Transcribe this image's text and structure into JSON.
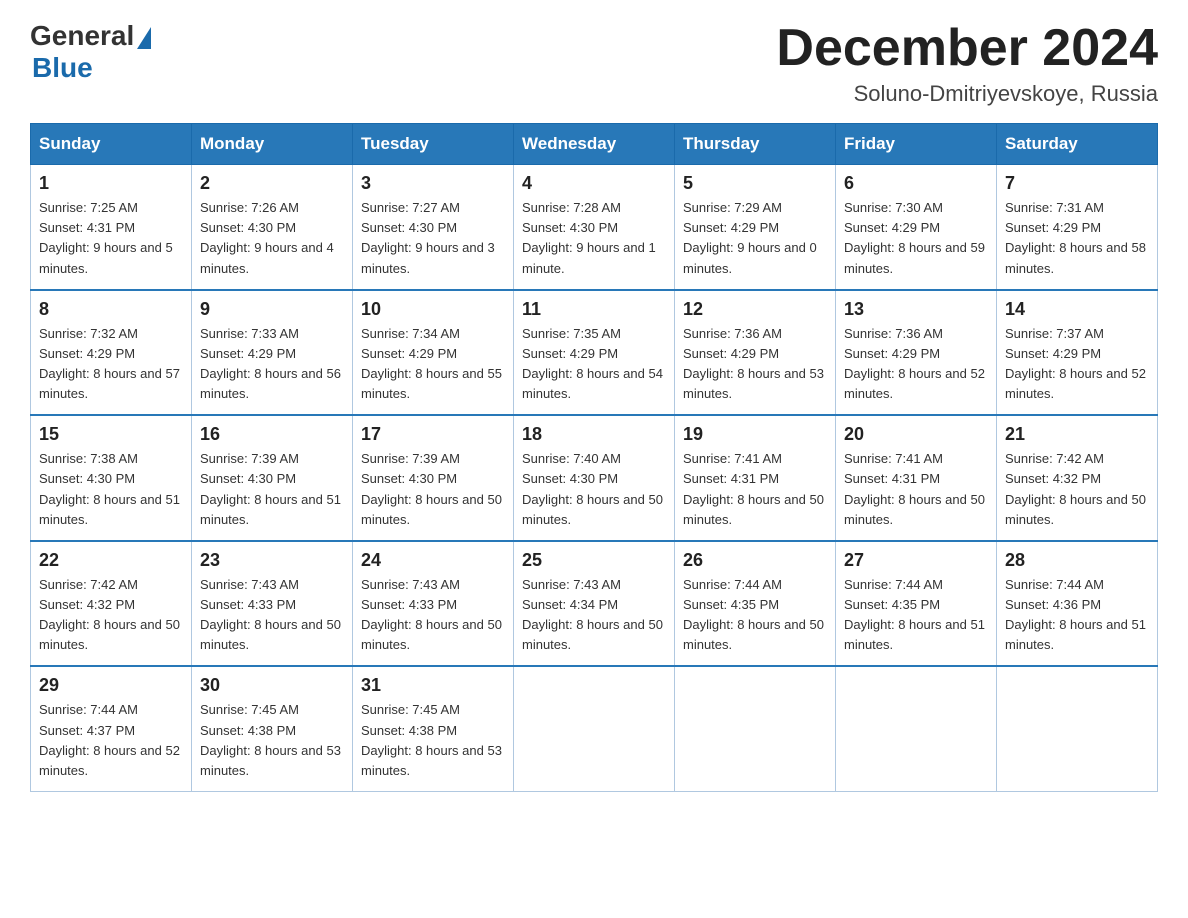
{
  "header": {
    "logo": {
      "general": "General",
      "blue": "Blue"
    },
    "title": "December 2024",
    "location": "Soluno-Dmitriyevskoye, Russia"
  },
  "calendar": {
    "days_of_week": [
      "Sunday",
      "Monday",
      "Tuesday",
      "Wednesday",
      "Thursday",
      "Friday",
      "Saturday"
    ],
    "weeks": [
      [
        {
          "day": "1",
          "sunrise": "7:25 AM",
          "sunset": "4:31 PM",
          "daylight": "9 hours and 5 minutes."
        },
        {
          "day": "2",
          "sunrise": "7:26 AM",
          "sunset": "4:30 PM",
          "daylight": "9 hours and 4 minutes."
        },
        {
          "day": "3",
          "sunrise": "7:27 AM",
          "sunset": "4:30 PM",
          "daylight": "9 hours and 3 minutes."
        },
        {
          "day": "4",
          "sunrise": "7:28 AM",
          "sunset": "4:30 PM",
          "daylight": "9 hours and 1 minute."
        },
        {
          "day": "5",
          "sunrise": "7:29 AM",
          "sunset": "4:29 PM",
          "daylight": "9 hours and 0 minutes."
        },
        {
          "day": "6",
          "sunrise": "7:30 AM",
          "sunset": "4:29 PM",
          "daylight": "8 hours and 59 minutes."
        },
        {
          "day": "7",
          "sunrise": "7:31 AM",
          "sunset": "4:29 PM",
          "daylight": "8 hours and 58 minutes."
        }
      ],
      [
        {
          "day": "8",
          "sunrise": "7:32 AM",
          "sunset": "4:29 PM",
          "daylight": "8 hours and 57 minutes."
        },
        {
          "day": "9",
          "sunrise": "7:33 AM",
          "sunset": "4:29 PM",
          "daylight": "8 hours and 56 minutes."
        },
        {
          "day": "10",
          "sunrise": "7:34 AM",
          "sunset": "4:29 PM",
          "daylight": "8 hours and 55 minutes."
        },
        {
          "day": "11",
          "sunrise": "7:35 AM",
          "sunset": "4:29 PM",
          "daylight": "8 hours and 54 minutes."
        },
        {
          "day": "12",
          "sunrise": "7:36 AM",
          "sunset": "4:29 PM",
          "daylight": "8 hours and 53 minutes."
        },
        {
          "day": "13",
          "sunrise": "7:36 AM",
          "sunset": "4:29 PM",
          "daylight": "8 hours and 52 minutes."
        },
        {
          "day": "14",
          "sunrise": "7:37 AM",
          "sunset": "4:29 PM",
          "daylight": "8 hours and 52 minutes."
        }
      ],
      [
        {
          "day": "15",
          "sunrise": "7:38 AM",
          "sunset": "4:30 PM",
          "daylight": "8 hours and 51 minutes."
        },
        {
          "day": "16",
          "sunrise": "7:39 AM",
          "sunset": "4:30 PM",
          "daylight": "8 hours and 51 minutes."
        },
        {
          "day": "17",
          "sunrise": "7:39 AM",
          "sunset": "4:30 PM",
          "daylight": "8 hours and 50 minutes."
        },
        {
          "day": "18",
          "sunrise": "7:40 AM",
          "sunset": "4:30 PM",
          "daylight": "8 hours and 50 minutes."
        },
        {
          "day": "19",
          "sunrise": "7:41 AM",
          "sunset": "4:31 PM",
          "daylight": "8 hours and 50 minutes."
        },
        {
          "day": "20",
          "sunrise": "7:41 AM",
          "sunset": "4:31 PM",
          "daylight": "8 hours and 50 minutes."
        },
        {
          "day": "21",
          "sunrise": "7:42 AM",
          "sunset": "4:32 PM",
          "daylight": "8 hours and 50 minutes."
        }
      ],
      [
        {
          "day": "22",
          "sunrise": "7:42 AM",
          "sunset": "4:32 PM",
          "daylight": "8 hours and 50 minutes."
        },
        {
          "day": "23",
          "sunrise": "7:43 AM",
          "sunset": "4:33 PM",
          "daylight": "8 hours and 50 minutes."
        },
        {
          "day": "24",
          "sunrise": "7:43 AM",
          "sunset": "4:33 PM",
          "daylight": "8 hours and 50 minutes."
        },
        {
          "day": "25",
          "sunrise": "7:43 AM",
          "sunset": "4:34 PM",
          "daylight": "8 hours and 50 minutes."
        },
        {
          "day": "26",
          "sunrise": "7:44 AM",
          "sunset": "4:35 PM",
          "daylight": "8 hours and 50 minutes."
        },
        {
          "day": "27",
          "sunrise": "7:44 AM",
          "sunset": "4:35 PM",
          "daylight": "8 hours and 51 minutes."
        },
        {
          "day": "28",
          "sunrise": "7:44 AM",
          "sunset": "4:36 PM",
          "daylight": "8 hours and 51 minutes."
        }
      ],
      [
        {
          "day": "29",
          "sunrise": "7:44 AM",
          "sunset": "4:37 PM",
          "daylight": "8 hours and 52 minutes."
        },
        {
          "day": "30",
          "sunrise": "7:45 AM",
          "sunset": "4:38 PM",
          "daylight": "8 hours and 53 minutes."
        },
        {
          "day": "31",
          "sunrise": "7:45 AM",
          "sunset": "4:38 PM",
          "daylight": "8 hours and 53 minutes."
        },
        null,
        null,
        null,
        null
      ]
    ]
  }
}
